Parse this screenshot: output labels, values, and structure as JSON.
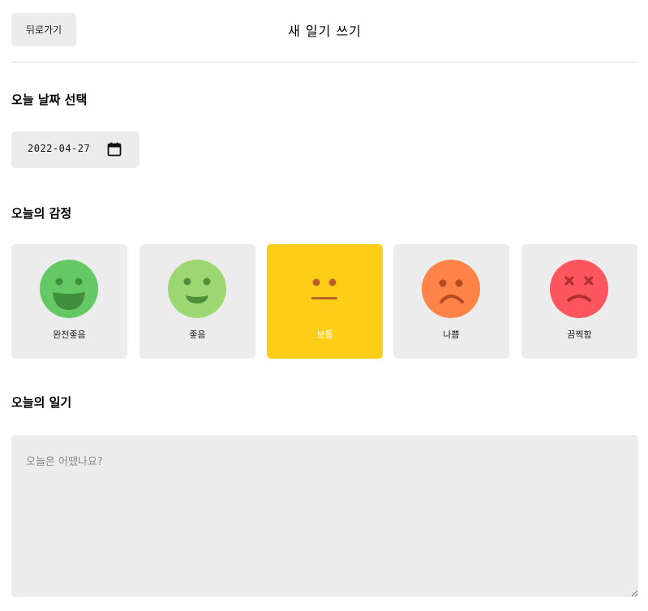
{
  "header": {
    "back_label": "뒤로가기",
    "title": "새 일기 쓰기"
  },
  "date_section": {
    "title": "오늘 날짜 선택",
    "value": "2022-04-27",
    "icon": "calendar-icon"
  },
  "emotion_section": {
    "title": "오늘의 감정",
    "selected_index": 2,
    "items": [
      {
        "label": "완전좋음",
        "color": "#64c964",
        "icon": "very-happy-face-icon"
      },
      {
        "label": "좋음",
        "color": "#9dd772",
        "icon": "happy-face-icon"
      },
      {
        "label": "보통",
        "color": "#fdce17",
        "icon": "neutral-face-icon"
      },
      {
        "label": "나쁨",
        "color": "#fd8446",
        "icon": "sad-face-icon"
      },
      {
        "label": "끔찍함",
        "color": "#fd565f",
        "icon": "terrible-face-icon"
      }
    ]
  },
  "diary_section": {
    "title": "오늘의 일기",
    "placeholder": "오늘은 어땠나요?",
    "value": ""
  },
  "colors": {
    "selected_bg": "#fdce17",
    "item_bg": "#ececec",
    "feature_dark": "#3f8f3f"
  }
}
